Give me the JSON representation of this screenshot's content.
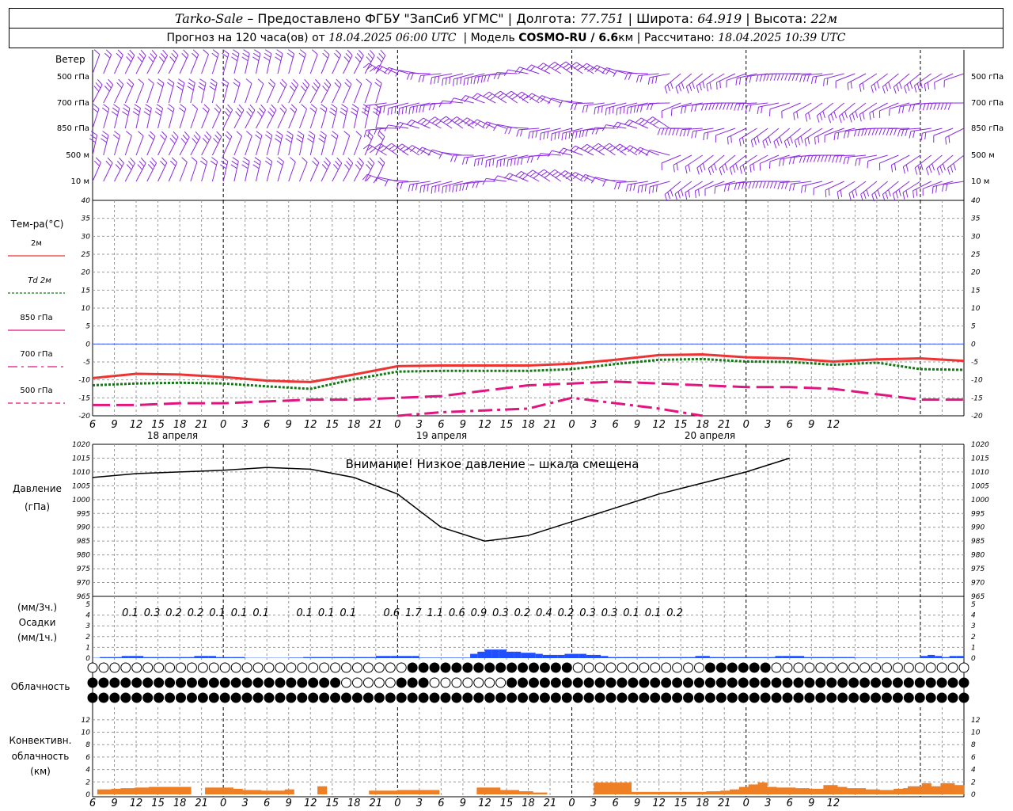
{
  "header": {
    "station": "Tarko-Sale",
    "provider": "– Предоставлено ФГБУ \"ЗапСиб УГМС\"",
    "lon_label": "| Долгота:",
    "lon_value": "77.751",
    "lat_label": "| Широта:",
    "lat_value": "64.919",
    "alt_label": "| Высота:",
    "alt_value": "22м",
    "forecast_label": "Прогноз на 120 часа(ов) от",
    "forecast_start": "18.04.2025 06:00 UTC",
    "model_label": "| Модель",
    "model_name": "COSMO-RU / 6.6",
    "model_unit": "км",
    "calc_label": "| Рассчитано:",
    "calc_time": "18.04.2025 10:39 UTC"
  },
  "wind_panel": {
    "title": "Ветер",
    "levels": [
      "500 гПа",
      "700 гПа",
      "850 гПа",
      "500 м",
      "10 м"
    ],
    "color": "#8a2be2"
  },
  "labels": {
    "temp_title": "Тем-ра(°С)",
    "legend": [
      {
        "label": "2м",
        "color": "#ee3333",
        "style": "solid"
      },
      {
        "label": "Td 2м",
        "color": "#127a12",
        "style": "dotted"
      },
      {
        "label": "850 гПа",
        "color": "#e0157f",
        "style": "solid"
      },
      {
        "label": "700 гПа",
        "color": "#e0157f",
        "style": "dashdot"
      },
      {
        "label": "500 гПа",
        "color": "#e0157f",
        "style": "dashed"
      }
    ],
    "pressure_title": "Давление",
    "pressure_unit": "(гПа)",
    "pressure_warning": "Внимание! Низкое давление – шкала смещена",
    "precip_unit3": "(мм/3ч.)",
    "precip_title": "Осадки",
    "precip_unit1": "(мм/1ч.)",
    "cloud_title": "Облачность",
    "conv_title1": "Конвективн.",
    "conv_title2": "облачность",
    "conv_unit": "(км)"
  },
  "time_axis": {
    "hour_labels": [
      "6",
      "9",
      "12",
      "15",
      "18",
      "21",
      "0",
      "3",
      "6",
      "9",
      "12",
      "15",
      "18",
      "21",
      "0",
      "3",
      "6",
      "9",
      "12",
      "15",
      "18",
      "21",
      "0",
      "3",
      "6",
      "9",
      "12",
      "15",
      "18",
      "21",
      "0",
      "3",
      "6",
      "9",
      "12"
    ],
    "day_labels": [
      "18 апреля",
      "19 апреля",
      "20 апреля"
    ]
  },
  "chart_data": [
    {
      "type": "line",
      "title": "Тем-ра(°С)",
      "ylim": [
        -20,
        40
      ],
      "yticks": [
        -20,
        -15,
        -10,
        -5,
        0,
        5,
        10,
        15,
        20,
        25,
        30,
        35,
        40
      ],
      "x_hours": [
        0,
        6,
        12,
        18,
        24,
        30,
        36,
        42,
        48,
        54,
        60,
        66,
        72,
        78,
        84,
        90,
        96,
        102,
        108,
        114,
        120
      ],
      "series": [
        {
          "name": "2м",
          "color": "#ee3333",
          "values": [
            -9.5,
            -8.3,
            -8.5,
            -9.2,
            -10.2,
            -10.6,
            -8.5,
            -6.2,
            -6.0,
            -6.0,
            -6.0,
            -5.5,
            -4.4,
            -3.1,
            -2.9,
            -3.7,
            -4.0,
            -4.9,
            -4.3,
            -4.0,
            -4.7
          ]
        },
        {
          "name": "Td 2м",
          "color": "#127a12",
          "values": [
            -11.5,
            -11.0,
            -10.8,
            -11.0,
            -11.8,
            -12.5,
            -9.8,
            -7.7,
            -7.5,
            -7.5,
            -7.5,
            -7.0,
            -5.6,
            -4.4,
            -4.2,
            -4.9,
            -5.0,
            -5.8,
            -5.2,
            -7.0,
            -7.2
          ]
        },
        {
          "name": "850 гПа",
          "color": "#e0157f",
          "values": [
            -17.0,
            -17.0,
            -16.5,
            -16.5,
            -16.0,
            -15.5,
            -15.5,
            -15.0,
            -14.5,
            -13.0,
            -11.5,
            -11.0,
            -10.5,
            -11.0,
            -11.5,
            -12.0,
            -12.0,
            -12.5,
            -14.0,
            -15.5,
            -15.5
          ]
        },
        {
          "name": "700 гПа",
          "color": "#e0157f",
          "values": [
            null,
            null,
            null,
            null,
            null,
            null,
            null,
            -20.0,
            -19.0,
            -18.5,
            -18.0,
            -15.0,
            -16.5,
            -18.0,
            -20.0,
            null,
            null,
            null,
            null,
            null,
            null
          ]
        }
      ]
    },
    {
      "type": "line",
      "title": "Давление",
      "ylabel": "(гПа)",
      "ylim": [
        965,
        1020
      ],
      "yticks": [
        965,
        970,
        975,
        980,
        985,
        990,
        995,
        1000,
        1005,
        1010,
        1015,
        1020
      ],
      "x_hours": [
        0,
        6,
        12,
        18,
        24,
        30,
        36,
        42,
        48,
        54,
        60,
        66,
        72,
        78,
        84,
        90,
        96,
        102,
        108,
        114,
        120
      ],
      "values": [
        1008,
        1009.4,
        1010,
        1010.6,
        1011.6,
        1011,
        1008,
        1002,
        990,
        985,
        987,
        992,
        997,
        1002,
        1006,
        1010,
        1015,
        null,
        null,
        null,
        null
      ]
    },
    {
      "type": "bar",
      "title": "Осадки",
      "ylim": [
        0,
        5
      ],
      "yticks": [
        0,
        1,
        2,
        3,
        4,
        5
      ],
      "labels_3h": [
        "0.1",
        "0.3",
        "0.2",
        "0.2",
        "0.1",
        "0.1",
        "0.1",
        "",
        "0.1",
        "0.1",
        "0.1",
        "",
        "0.6",
        "1.7",
        "1.1",
        "0.6",
        "0.9",
        "0.3",
        "0.2",
        "0.4",
        "0.2",
        "0.3",
        "0.3",
        "0.1",
        "0.1",
        "0.2"
      ],
      "hourly_values": [
        0.03,
        0.1,
        0.1,
        0.1,
        0.2,
        0.2,
        0.2,
        0.1,
        0.1,
        0.1,
        0.1,
        0.1,
        0.1,
        0.1,
        0.2,
        0.2,
        0.2,
        0.1,
        0.1,
        0.1,
        0.1,
        0.03,
        0.03,
        0.03,
        0.03,
        0.03,
        0.03,
        0.05,
        0.05,
        0.1,
        0.1,
        0.1,
        0.1,
        0.1,
        0.1,
        0.1,
        0.1,
        0.1,
        0.1,
        0.2,
        0.2,
        0.2,
        0.2,
        0.2,
        0.2,
        0.05,
        0.05,
        0.05,
        0.05,
        0.05,
        0.05,
        0.05,
        0.4,
        0.6,
        0.8,
        0.8,
        0.8,
        0.6,
        0.6,
        0.5,
        0.5,
        0.4,
        0.3,
        0.3,
        0.3,
        0.4,
        0.4,
        0.4,
        0.3,
        0.3,
        0.2,
        0.1,
        0.1,
        0.1,
        0.1,
        0.1,
        0.1,
        0.1,
        0.1,
        0.1,
        0.1,
        0.1,
        0.1,
        0.2,
        0.2,
        0.1,
        0.1,
        0.1,
        0.1,
        0.1,
        0.1,
        0.1,
        0.1,
        0.1,
        0.2,
        0.2,
        0.2,
        0.2,
        0.1,
        0.1,
        0.1,
        0.1,
        0.1,
        0.1,
        0.1,
        0.05,
        0.05,
        0.05,
        0.05,
        0.05,
        0.05,
        0.05,
        0.05,
        0.05,
        0.2,
        0.3,
        0.2,
        0.1,
        0.2,
        0.2
      ],
      "color": "#1f4fff"
    },
    {
      "type": "bar",
      "title": "Конвективн. облачность",
      "ylabel": "(км)",
      "ylim": [
        0,
        13
      ],
      "yticks": [
        0,
        2,
        4,
        6,
        8,
        10,
        12
      ],
      "hourly_values": [
        0,
        0.8,
        0.8,
        0.8,
        0.9,
        0.9,
        1,
        1,
        1,
        1.1,
        1.1,
        1.1,
        1.2,
        1.2,
        1.2,
        1.2,
        1.2,
        1.2,
        1.2,
        1.2,
        1.2,
        0,
        0,
        0,
        1.1,
        1.1,
        1.1,
        1.1,
        1.1,
        1.1,
        0.9,
        0.9,
        0.7,
        0.7,
        0.7,
        0.7,
        0.6,
        0.6,
        0.6,
        0.6,
        0.6,
        0.8,
        0.8,
        0,
        0,
        0,
        0,
        0,
        1.3,
        1.3,
        0,
        0,
        0,
        0,
        0,
        0,
        0,
        0,
        0,
        0.6,
        0.6,
        0.6,
        0.6,
        0.6,
        0.6,
        0.7,
        0.7,
        0.7,
        0.7,
        0.7,
        0.7,
        0.7,
        0.7,
        0.7,
        0,
        0,
        0,
        0,
        0,
        0,
        0,
        0,
        1.1,
        1.1,
        1.1,
        1.1,
        1.1,
        0.7,
        0.7,
        0.7,
        0.7,
        0.5,
        0.5,
        0.5,
        0.3,
        0.3,
        0.3,
        0,
        0,
        0,
        0,
        0,
        0,
        0,
        0,
        0,
        0,
        1.9,
        1.9,
        1.9,
        1.9,
        1.9,
        1.9,
        1.9,
        1.9,
        0.4,
        0.4,
        0.4,
        0.4,
        0.4,
        0.4,
        0.4,
        0.4,
        0.4,
        0.4,
        0.4,
        0.4,
        0.4,
        0.4,
        0.4,
        0.4,
        0.5,
        0.5,
        0.5,
        0.6,
        0.6,
        0.8,
        0.8,
        1.2,
        1.2,
        1.6,
        1.6,
        1.9,
        1.9,
        1.2,
        1.2,
        1.1,
        1.1,
        1.1,
        1.1,
        1.0,
        1.0,
        1.0,
        0.9,
        0.9,
        0.9,
        1.5,
        1.5,
        1.5,
        1.2,
        1.2,
        1.0,
        1.0,
        1.0,
        1.0,
        0.8,
        0.8,
        0.8,
        0.7,
        0.7,
        0.7,
        0.9,
        0.9,
        1.0,
        1.3,
        1.3,
        1.3,
        1.8,
        1.8,
        1.3,
        1.3,
        1.8,
        1.8,
        1.8,
        1.5,
        1.5
      ],
      "color": "#ee7f24"
    }
  ]
}
